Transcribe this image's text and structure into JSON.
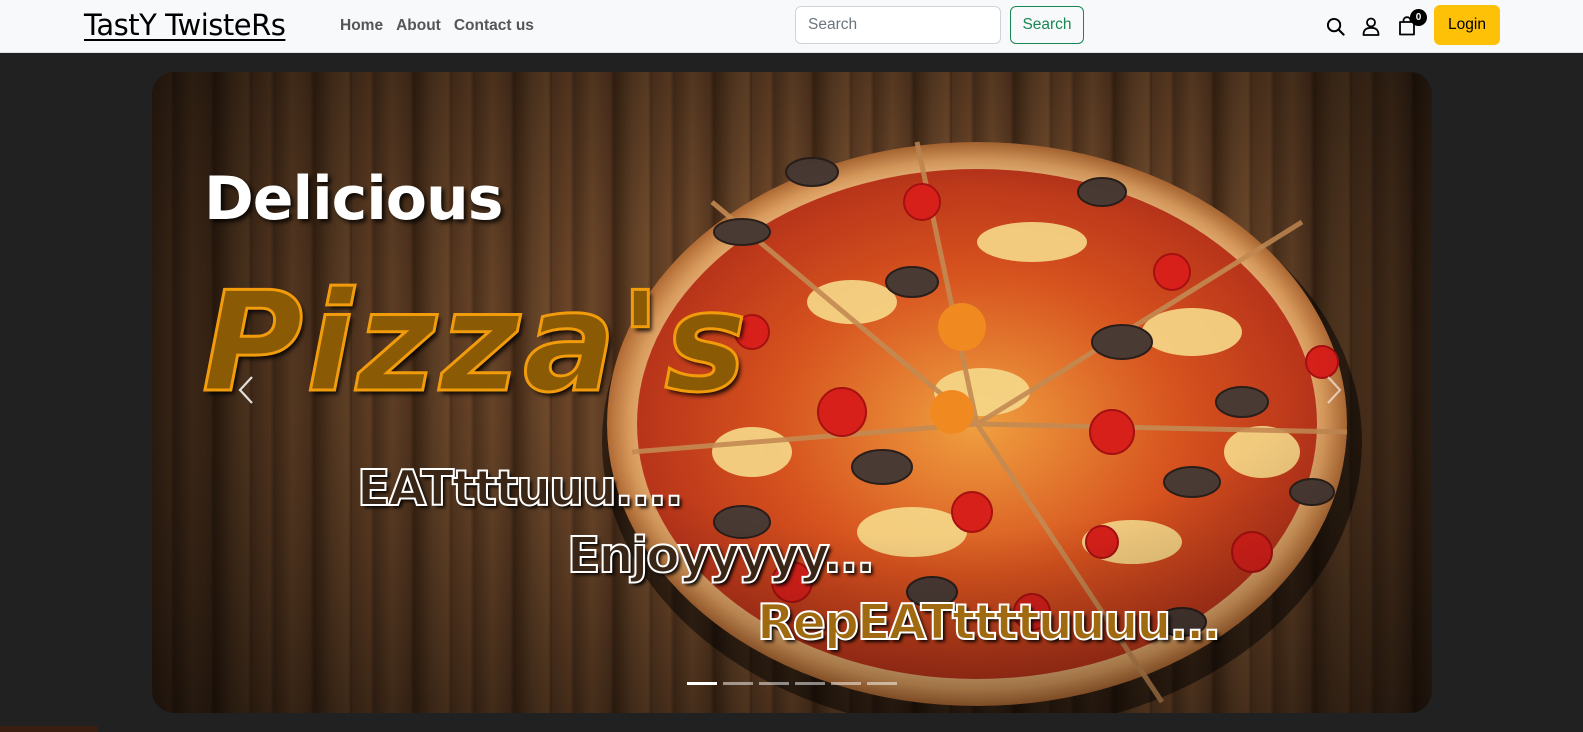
{
  "navbar": {
    "brand": "TastY TwisteRs",
    "links": [
      "Home",
      "About",
      "Contact us"
    ],
    "search_placeholder": "Search",
    "search_button": "Search",
    "cart_count": "0",
    "login_label": "Login"
  },
  "hero": {
    "line1": "Delicious",
    "line2": "Pizza's",
    "line3": "EATtttuuu....",
    "line4": "Enjoyyyyy...",
    "line5": "RepEATttttuuuu...",
    "slide_count": 6,
    "active_slide": 1
  },
  "colors": {
    "navbar_bg": "#f8f9fa",
    "page_bg": "#212121",
    "search_accent": "#198754",
    "login_bg": "#ffc107",
    "pizza_text_fill": "#8a5a05",
    "pizza_text_outline": "#f29c0b"
  },
  "icons": [
    "search-icon",
    "user-icon",
    "shopping-bag-icon",
    "chevron-left-icon",
    "chevron-right-icon"
  ]
}
